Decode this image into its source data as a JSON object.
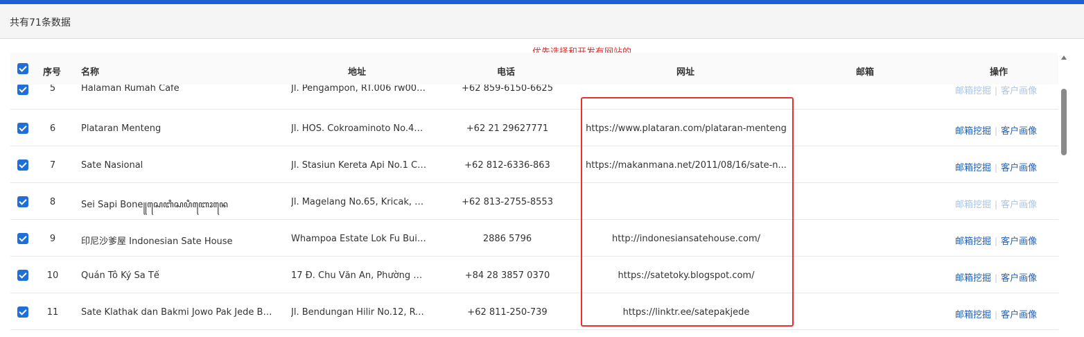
{
  "header": {
    "count_text": "共有71条数据"
  },
  "annotation": "优先选择和开发有网站的",
  "columns": {
    "index": "序号",
    "name": "名称",
    "address": "地址",
    "phone": "电话",
    "website": "网址",
    "email": "邮箱",
    "actions": "操作"
  },
  "actions": {
    "mine_email": "邮箱挖掘",
    "profile": "客户画像",
    "separator": "|"
  },
  "rows": [
    {
      "index": "5",
      "name": "Halaman Rumah Cafe",
      "address": "Jl. Pengampon, RT.006 rw003,...",
      "phone": "+62 859-6150-6625",
      "website": "",
      "email": "",
      "enabled": false
    },
    {
      "index": "6",
      "name": "Plataran Menteng",
      "address": "Jl. HOS. Cokroaminoto No.42...",
      "phone": "+62 21 29627771",
      "website": "https://www.plataran.com/plataran-menteng",
      "email": "",
      "enabled": true
    },
    {
      "index": "7",
      "name": "Sate Nasional",
      "address": "Jl. Stasiun Kereta Api No.1 C, ...",
      "phone": "+62 812-6336-863",
      "website": "https://makanmana.net/2011/08/16/sate-n...",
      "email": "",
      "enabled": true
    },
    {
      "index": "8",
      "name": "Sei Sapi Bone꧋ꦱꦺꦧꦶꦱꦥꦶꦧꦺꦴꦤꦺ",
      "address": "Jl. Magelang No.65, Kricak, K...",
      "phone": "+62 813-2755-8553",
      "website": "",
      "email": "",
      "enabled": false
    },
    {
      "index": "9",
      "name": "印尼沙爹屋 Indonesian Sate House",
      "address": "Whampoa Estate Lok Fu Buil...",
      "phone": "2886 5796",
      "website": "http://indonesiansatehouse.com/",
      "email": "",
      "enabled": true
    },
    {
      "index": "10",
      "name": "Quán Tô Ký Sa Tế",
      "address": "17 Đ. Chu Văn An, Phường 1, ...",
      "phone": "+84 28 3857 0370",
      "website": "https://satetoky.blogspot.com/",
      "email": "",
      "enabled": true
    },
    {
      "index": "11",
      "name": "Sate Klathak dan Bakmi Jowo Pak Jede Ben...",
      "address": "Jl. Bendungan Hilir No.12, RT....",
      "phone": "+62 811-250-739",
      "website": "https://linktr.ee/satepakjede",
      "email": "",
      "enabled": true
    }
  ]
}
